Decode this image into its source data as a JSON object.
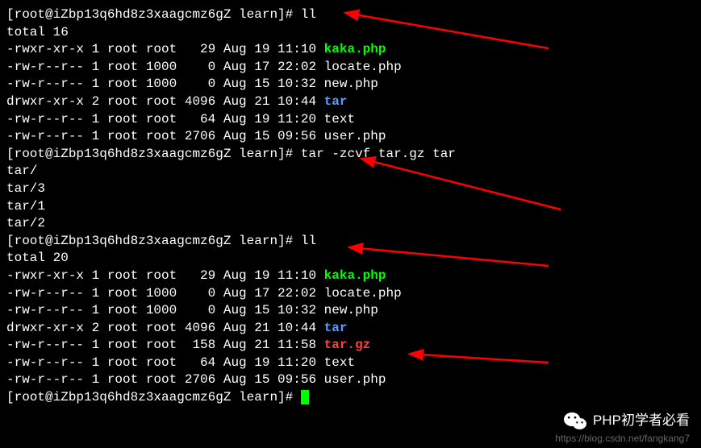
{
  "prompt": {
    "user": "root",
    "host": "iZbp13q6hd8z3xaagcmz6gZ",
    "dir": "learn",
    "symbol": "#"
  },
  "cmd1": "ll",
  "total1": "total 16",
  "ls1": [
    {
      "perm": "-rwxr-xr-x",
      "links": "1",
      "owner": "root",
      "group": "root",
      "size": "  29",
      "date": "Aug 19 11:10",
      "name": "kaka.php",
      "cls": "green"
    },
    {
      "perm": "-rw-r--r--",
      "links": "1",
      "owner": "root",
      "group": "1000",
      "size": "   0",
      "date": "Aug 17 22:02",
      "name": "locate.php",
      "cls": ""
    },
    {
      "perm": "-rw-r--r--",
      "links": "1",
      "owner": "root",
      "group": "1000",
      "size": "   0",
      "date": "Aug 15 10:32",
      "name": "new.php",
      "cls": ""
    },
    {
      "perm": "drwxr-xr-x",
      "links": "2",
      "owner": "root",
      "group": "root",
      "size": "4096",
      "date": "Aug 21 10:44",
      "name": "tar",
      "cls": "blue"
    },
    {
      "perm": "-rw-r--r--",
      "links": "1",
      "owner": "root",
      "group": "root",
      "size": "  64",
      "date": "Aug 19 11:20",
      "name": "text",
      "cls": ""
    },
    {
      "perm": "-rw-r--r--",
      "links": "1",
      "owner": "root",
      "group": "root",
      "size": "2706",
      "date": "Aug 15 09:56",
      "name": "user.php",
      "cls": ""
    }
  ],
  "cmd2": "tar -zcvf tar.gz tar",
  "tarout": [
    "tar/",
    "tar/3",
    "tar/1",
    "tar/2"
  ],
  "cmd3": "ll",
  "total2": "total 20",
  "ls2": [
    {
      "perm": "-rwxr-xr-x",
      "links": "1",
      "owner": "root",
      "group": "root",
      "size": "  29",
      "date": "Aug 19 11:10",
      "name": "kaka.php",
      "cls": "green"
    },
    {
      "perm": "-rw-r--r--",
      "links": "1",
      "owner": "root",
      "group": "1000",
      "size": "   0",
      "date": "Aug 17 22:02",
      "name": "locate.php",
      "cls": ""
    },
    {
      "perm": "-rw-r--r--",
      "links": "1",
      "owner": "root",
      "group": "1000",
      "size": "   0",
      "date": "Aug 15 10:32",
      "name": "new.php",
      "cls": ""
    },
    {
      "perm": "drwxr-xr-x",
      "links": "2",
      "owner": "root",
      "group": "root",
      "size": "4096",
      "date": "Aug 21 10:44",
      "name": "tar",
      "cls": "blue"
    },
    {
      "perm": "-rw-r--r--",
      "links": "1",
      "owner": "root",
      "group": "root",
      "size": " 158",
      "date": "Aug 21 11:58",
      "name": "tar.gz",
      "cls": "red"
    },
    {
      "perm": "-rw-r--r--",
      "links": "1",
      "owner": "root",
      "group": "root",
      "size": "  64",
      "date": "Aug 19 11:20",
      "name": "text",
      "cls": ""
    },
    {
      "perm": "-rw-r--r--",
      "links": "1",
      "owner": "root",
      "group": "root",
      "size": "2706",
      "date": "Aug 15 09:56",
      "name": "user.php",
      "cls": ""
    }
  ],
  "watermark_text": "PHP初学者必看",
  "blog_url": "https://blog.csdn.net/fangkang7"
}
